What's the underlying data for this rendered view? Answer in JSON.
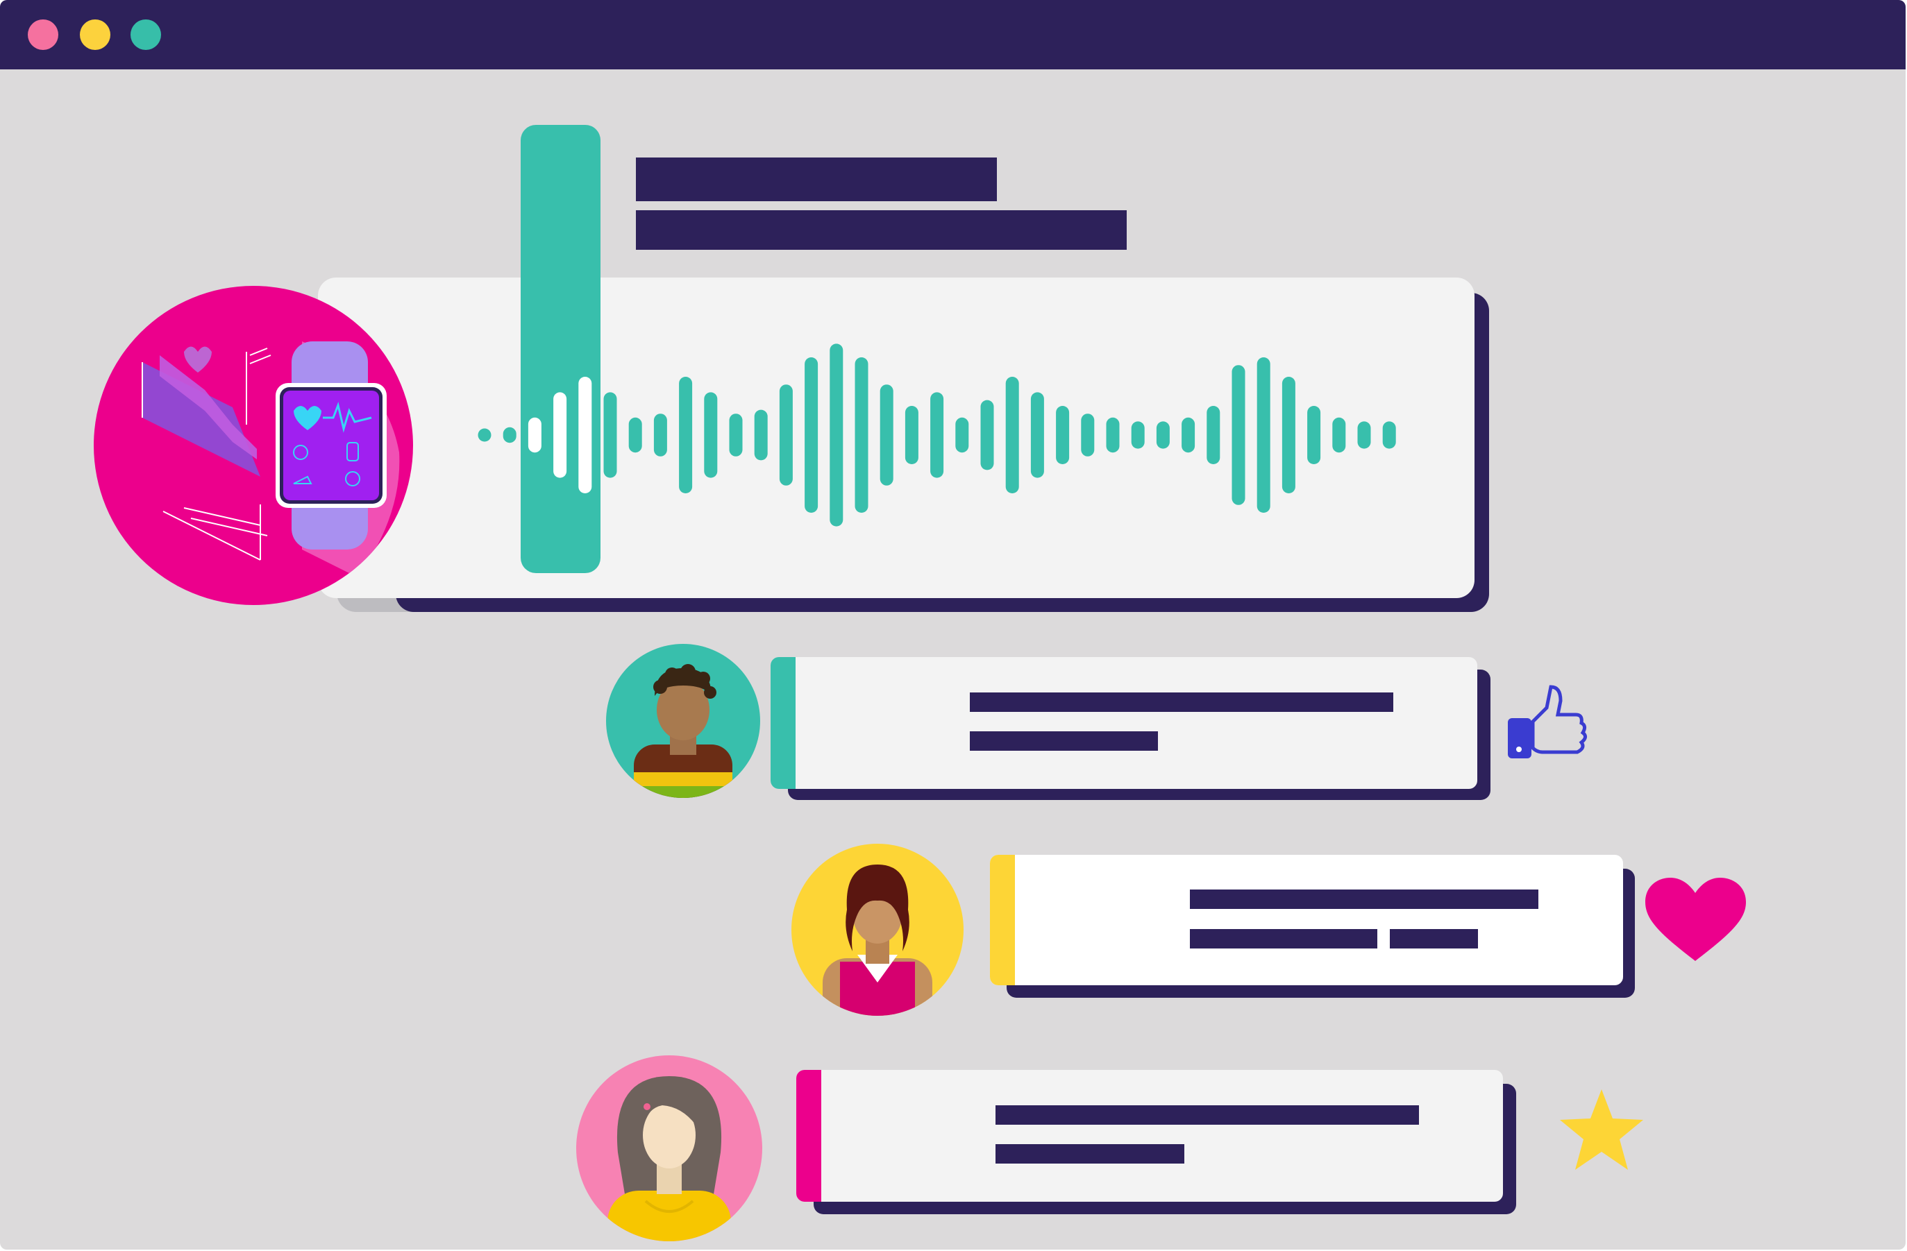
{
  "window": {
    "controls": [
      "close-dot",
      "minimize-dot",
      "maximize-dot"
    ]
  },
  "colors": {
    "titlebar": "#2d215a",
    "background": "#dcdadb",
    "card": "#f3f3f3",
    "card_white": "#ffffff",
    "teal": "#38bfac",
    "pink": "#ec008c",
    "light_pink": "#f782b3",
    "yellow": "#fdd536",
    "purple": "#a020f0",
    "lavender": "#a990f0",
    "blue": "#3a3cd0",
    "dot_red": "#f5719f",
    "dot_yellow": "#fcd23d",
    "dot_green": "#37bea9"
  },
  "voice_message": {
    "waveform_levels": [
      2,
      4,
      9,
      22,
      30,
      22,
      9,
      11,
      30,
      22,
      11,
      13,
      26,
      40,
      47,
      40,
      26,
      15,
      22,
      9,
      18,
      30,
      22,
      15,
      11,
      9,
      7,
      7,
      9,
      15,
      36,
      40,
      30,
      15,
      9,
      7,
      7
    ]
  },
  "messages": [
    {
      "avatar": "avatar-man-icon",
      "reaction": "thumbs-up-icon",
      "accent": "#38bfac"
    },
    {
      "avatar": "avatar-woman-curly-icon",
      "reaction": "heart-icon",
      "accent": "#fdd536"
    },
    {
      "avatar": "avatar-woman-icon",
      "reaction": "star-icon",
      "accent": "#ec008c"
    }
  ],
  "icons": [
    "smartwatch-health-icon",
    "thumbs-up-icon",
    "heart-icon",
    "star-icon"
  ]
}
